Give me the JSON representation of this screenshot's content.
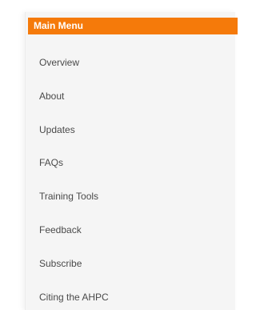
{
  "menu": {
    "title": "Main Menu",
    "accent_color": "#f57a0a",
    "items": [
      {
        "label": "Overview"
      },
      {
        "label": "About"
      },
      {
        "label": "Updates"
      },
      {
        "label": "FAQs"
      },
      {
        "label": "Training Tools"
      },
      {
        "label": "Feedback"
      },
      {
        "label": "Subscribe"
      },
      {
        "label": "Citing the AHPC"
      }
    ]
  }
}
